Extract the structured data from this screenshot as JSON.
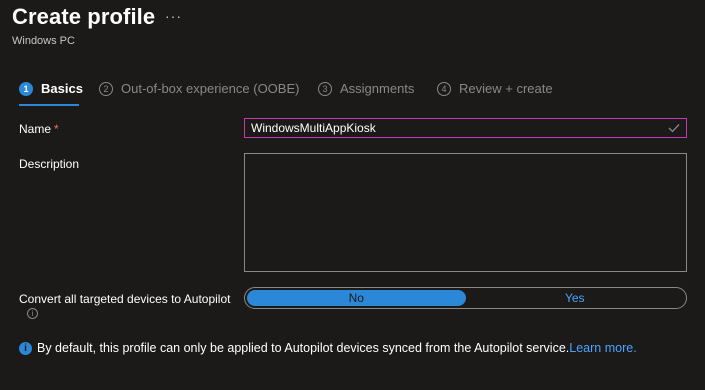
{
  "header": {
    "title": "Create profile",
    "more_icon": "ellipsis-icon",
    "subtitle": "Windows PC"
  },
  "steps": [
    {
      "number": "1",
      "label": "Basics",
      "active": true
    },
    {
      "number": "2",
      "label": "Out-of-box experience (OOBE)",
      "active": false
    },
    {
      "number": "3",
      "label": "Assignments",
      "active": false
    },
    {
      "number": "4",
      "label": "Review + create",
      "active": false
    }
  ],
  "form": {
    "name_label": "Name",
    "name_required": "*",
    "name_value": "WindowsMultiAppKiosk",
    "description_label": "Description",
    "description_value": "",
    "autopilot_label": "Convert all targeted devices to Autopilot",
    "autopilot_options": [
      "No",
      "Yes"
    ],
    "autopilot_selected": "No"
  },
  "notice": {
    "text": "By default, this profile can only be applied to Autopilot devices synced from the Autopilot service.",
    "link": "Learn more."
  },
  "colors": {
    "accent": "#2b88d8",
    "link": "#4aa3ff",
    "focus_border": "#c239b3",
    "required": "#f1707b",
    "background": "#1b1a19"
  }
}
